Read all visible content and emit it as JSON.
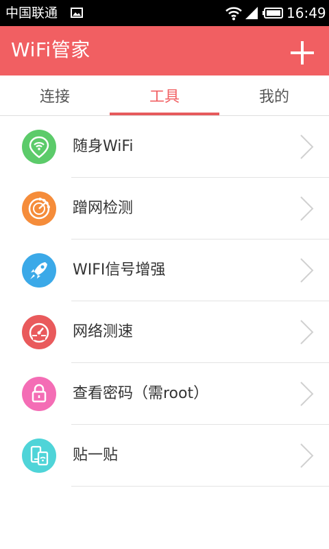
{
  "status_bar": {
    "carrier": "中国联通",
    "time": "16:49"
  },
  "header": {
    "title": "WiFi管家"
  },
  "tabs": [
    {
      "label": "连接",
      "active": false
    },
    {
      "label": "工具",
      "active": true
    },
    {
      "label": "我的",
      "active": false
    }
  ],
  "tools": [
    {
      "label": "随身WiFi",
      "icon": "location-wifi-icon",
      "color": "#5ccb6a"
    },
    {
      "label": "蹭网检测",
      "icon": "radar-icon",
      "color": "#f58c3a"
    },
    {
      "label": "WIFI信号增强",
      "icon": "rocket-icon",
      "color": "#3ba9e8"
    },
    {
      "label": "网络测速",
      "icon": "speedometer-icon",
      "color": "#e95a5c"
    },
    {
      "label": "查看密码（需root）",
      "icon": "lock-icon",
      "color": "#f46db5"
    },
    {
      "label": "贴一贴",
      "icon": "phone-tap-icon",
      "color": "#4fd4d8"
    }
  ],
  "colors": {
    "accent": "#f15f62",
    "status_bar": "#000000"
  }
}
